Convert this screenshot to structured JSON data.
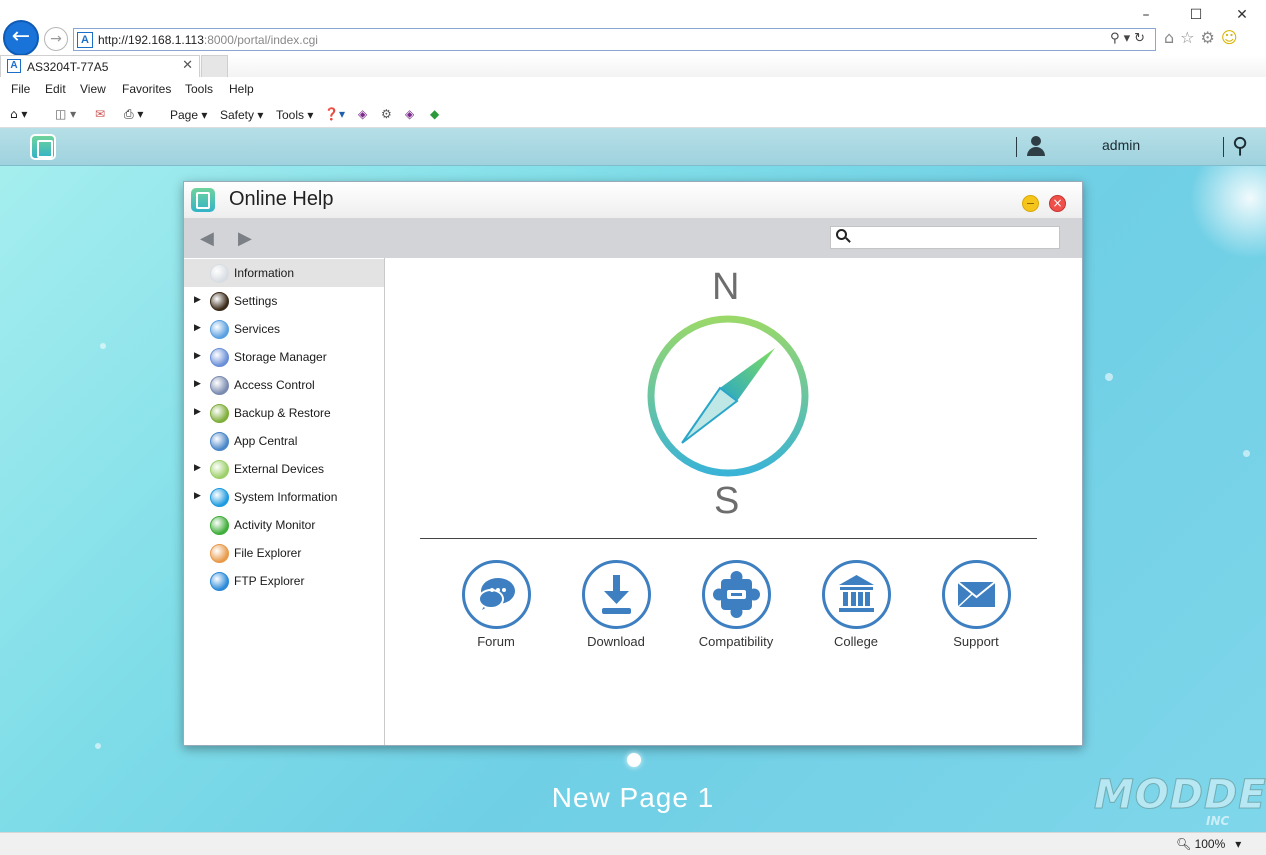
{
  "browser": {
    "window_controls": [
      "–",
      "☐",
      "✕"
    ],
    "url_host": "http://192.168.1.113",
    "url_rest": ":8000/portal/index.cgi",
    "tab_title": "AS3204T-77A5",
    "menu": [
      "File",
      "Edit",
      "View",
      "Favorites",
      "Tools",
      "Help"
    ],
    "command_bar": {
      "page": "Page",
      "safety": "Safety",
      "tools": "Tools"
    },
    "zoom": "100%"
  },
  "portal": {
    "username": "admin",
    "page_label": "New Page 1",
    "watermark": "MODDERS",
    "watermark_sub": "INC"
  },
  "help_window": {
    "title": "Online Help",
    "search_placeholder": "",
    "sidebar": [
      {
        "label": "Information",
        "expandable": false,
        "selected": true,
        "icon": "compass-icon",
        "color": "#d8dde3"
      },
      {
        "label": "Settings",
        "expandable": true,
        "selected": false,
        "icon": "settings-icon",
        "color": "#3a2a18"
      },
      {
        "label": "Services",
        "expandable": true,
        "selected": false,
        "icon": "services-icon",
        "color": "#5aa0e0"
      },
      {
        "label": "Storage Manager",
        "expandable": true,
        "selected": false,
        "icon": "storage-manager-icon",
        "color": "#6a8fd8"
      },
      {
        "label": "Access Control",
        "expandable": true,
        "selected": false,
        "icon": "access-control-icon",
        "color": "#7a8bb0"
      },
      {
        "label": "Backup & Restore",
        "expandable": true,
        "selected": false,
        "icon": "backup-restore-icon",
        "color": "#7fae3a"
      },
      {
        "label": "App Central",
        "expandable": false,
        "selected": false,
        "icon": "app-central-icon",
        "color": "#4a86c8"
      },
      {
        "label": "External Devices",
        "expandable": true,
        "selected": false,
        "icon": "external-devices-icon",
        "color": "#9ccf6a"
      },
      {
        "label": "System Information",
        "expandable": true,
        "selected": false,
        "icon": "system-information-icon",
        "color": "#1e9be0"
      },
      {
        "label": "Activity Monitor",
        "expandable": false,
        "selected": false,
        "icon": "activity-monitor-icon",
        "color": "#3fae3a"
      },
      {
        "label": "File Explorer",
        "expandable": false,
        "selected": false,
        "icon": "file-explorer-icon",
        "color": "#e89a4a"
      },
      {
        "label": "FTP Explorer",
        "expandable": false,
        "selected": false,
        "icon": "ftp-explorer-icon",
        "color": "#2a8ad8"
      }
    ],
    "compass": {
      "north": "N",
      "south": "S"
    },
    "links": [
      {
        "label": "Forum",
        "icon": "forum-icon"
      },
      {
        "label": "Download",
        "icon": "download-icon"
      },
      {
        "label": "Compatibility",
        "icon": "compatibility-icon"
      },
      {
        "label": "College",
        "icon": "college-icon"
      },
      {
        "label": "Support",
        "icon": "support-icon"
      }
    ],
    "accent_color": "#3d7fc1"
  }
}
